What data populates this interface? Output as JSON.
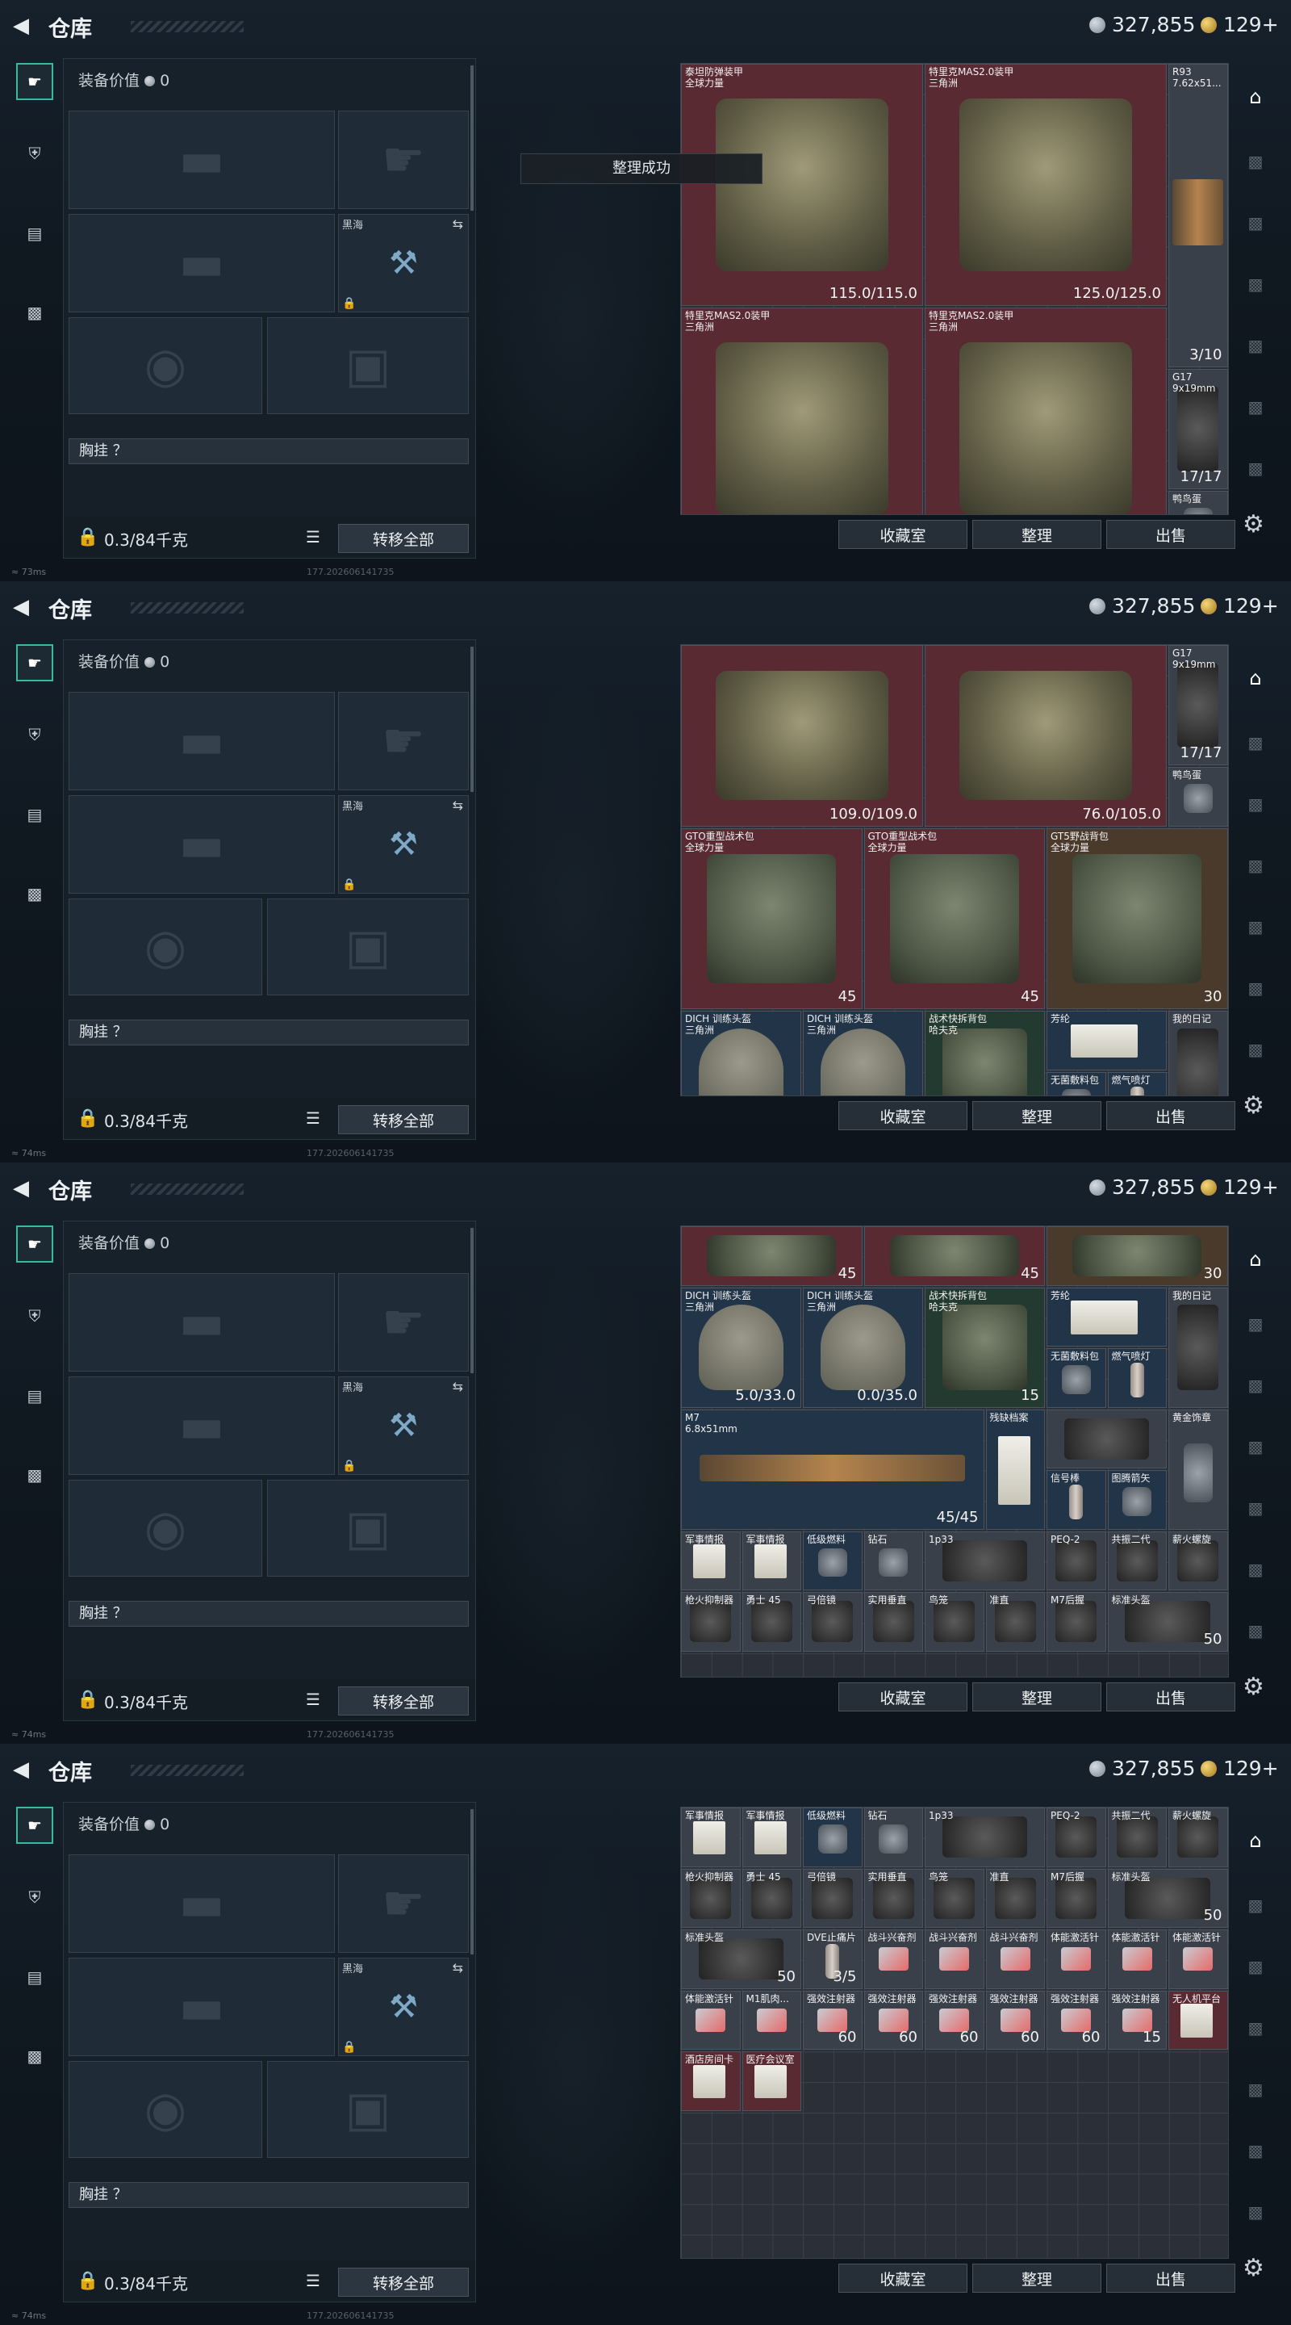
{
  "header": {
    "title": "仓库",
    "silver": "327,855",
    "gold": "129+"
  },
  "left_panel": {
    "equip_value_label": "装备价值",
    "equip_value": "0",
    "melee_name": "黑海",
    "vest_label": "胸挂 ？",
    "weight": "0.3/84千克",
    "transfer_all": "转移全部"
  },
  "footer_buttons": {
    "collection": "收藏室",
    "sort": "整理",
    "sell": "出售"
  },
  "toast": "整理成功",
  "frames": [
    {
      "ping": "73ms",
      "build": "177.202606141735",
      "items": [
        {
          "name": "泰坦防弹装甲\n全球力量",
          "value": "115.0/115.0",
          "x": 0,
          "y": 0,
          "w": 4,
          "h": 4,
          "bg": "red",
          "pic": "vest"
        },
        {
          "name": "特里克MAS2.0装甲\n三角洲",
          "value": "125.0/125.0",
          "x": 4,
          "y": 0,
          "w": 4,
          "h": 4,
          "bg": "red",
          "pic": "vest"
        },
        {
          "name": "R93\n7.62x51...",
          "value": "3/10",
          "x": 8,
          "y": 0,
          "w": 1,
          "h": 5,
          "bg": "gry",
          "pic": "gun"
        },
        {
          "name": "特里克MAS2.0装甲\n三角洲",
          "value": "",
          "x": 0,
          "y": 4,
          "w": 4,
          "h": 4,
          "bg": "red",
          "pic": "vest"
        },
        {
          "name": "特里克MAS2.0装甲\n三角洲",
          "value": "",
          "x": 4,
          "y": 4,
          "w": 4,
          "h": 4,
          "bg": "red",
          "pic": "vest"
        },
        {
          "name": "G17\n9x19mm",
          "value": "17/17",
          "x": 8,
          "y": 5,
          "w": 1,
          "h": 2,
          "bg": "gry",
          "pic": "dark"
        },
        {
          "name": "鸭鸟蛋",
          "value": "",
          "x": 8,
          "y": 7,
          "w": 1,
          "h": 1,
          "bg": "gry",
          "pic": "sm"
        }
      ]
    },
    {
      "ping": "74ms",
      "build": "177.202606141735",
      "items": [
        {
          "name": "",
          "value": "109.0/109.0",
          "x": 0,
          "y": 0,
          "w": 4,
          "h": 3,
          "bg": "red",
          "pic": "vest"
        },
        {
          "name": "",
          "value": "76.0/105.0",
          "x": 4,
          "y": 0,
          "w": 4,
          "h": 3,
          "bg": "red",
          "pic": "vest"
        },
        {
          "name": "G17\n9x19mm",
          "value": "17/17",
          "x": 8,
          "y": 0,
          "w": 1,
          "h": 2,
          "bg": "gry",
          "pic": "dark"
        },
        {
          "name": "鸭鸟蛋",
          "value": "",
          "x": 8,
          "y": 2,
          "w": 1,
          "h": 1,
          "bg": "gry",
          "pic": "sm"
        },
        {
          "name": "GTO重型战术包\n全球力量",
          "value": "45",
          "x": 0,
          "y": 3,
          "w": 3,
          "h": 3,
          "bg": "red",
          "pic": "pack"
        },
        {
          "name": "GTO重型战术包\n全球力量",
          "value": "45",
          "x": 3,
          "y": 3,
          "w": 3,
          "h": 3,
          "bg": "red",
          "pic": "pack"
        },
        {
          "name": "GT5野战背包\n全球力量",
          "value": "30",
          "x": 6,
          "y": 3,
          "w": 3,
          "h": 3,
          "bg": "brn",
          "pic": "pack"
        },
        {
          "name": "DICH 训练头盔\n三角洲",
          "value": "",
          "x": 0,
          "y": 6,
          "w": 2,
          "h": 2,
          "bg": "blu",
          "pic": "helm"
        },
        {
          "name": "DICH 训练头盔\n三角洲",
          "value": "",
          "x": 2,
          "y": 6,
          "w": 2,
          "h": 2,
          "bg": "blu",
          "pic": "helm"
        },
        {
          "name": "战术快拆背包\n哈夫克",
          "value": "",
          "x": 4,
          "y": 6,
          "w": 2,
          "h": 2,
          "bg": "grn",
          "pic": "pack"
        },
        {
          "name": "芳纶",
          "value": "",
          "x": 6,
          "y": 6,
          "w": 2,
          "h": 1,
          "bg": "blu",
          "pic": "doc"
        },
        {
          "name": "我的日记",
          "value": "",
          "x": 8,
          "y": 6,
          "w": 1,
          "h": 2,
          "bg": "gry",
          "pic": "dark"
        },
        {
          "name": "无菌敷料包",
          "value": "",
          "x": 6,
          "y": 7,
          "w": 1,
          "h": 1,
          "bg": "blu",
          "pic": "sm"
        },
        {
          "name": "燃气喷灯",
          "value": "",
          "x": 7,
          "y": 7,
          "w": 1,
          "h": 1,
          "bg": "blu",
          "pic": "cyl"
        }
      ]
    },
    {
      "ping": "74ms",
      "build": "177.202606141735",
      "items": [
        {
          "name": "",
          "value": "45",
          "x": 0,
          "y": 0,
          "w": 3,
          "h": 1,
          "bg": "red",
          "pic": "pack"
        },
        {
          "name": "",
          "value": "45",
          "x": 3,
          "y": 0,
          "w": 3,
          "h": 1,
          "bg": "red",
          "pic": "pack"
        },
        {
          "name": "",
          "value": "30",
          "x": 6,
          "y": 0,
          "w": 3,
          "h": 1,
          "bg": "brn",
          "pic": "pack"
        },
        {
          "name": "DICH 训练头盔\n三角洲",
          "value": "5.0/33.0",
          "x": 0,
          "y": 1,
          "w": 2,
          "h": 2,
          "bg": "blu",
          "pic": "helm"
        },
        {
          "name": "DICH 训练头盔\n三角洲",
          "value": "0.0/35.0",
          "x": 2,
          "y": 1,
          "w": 2,
          "h": 2,
          "bg": "blu",
          "pic": "helm"
        },
        {
          "name": "战术快拆背包\n哈夫克",
          "value": "15",
          "x": 4,
          "y": 1,
          "w": 2,
          "h": 2,
          "bg": "grn",
          "pic": "pack"
        },
        {
          "name": "芳纶",
          "value": "",
          "x": 6,
          "y": 1,
          "w": 2,
          "h": 1,
          "bg": "blu",
          "pic": "doc"
        },
        {
          "name": "我的日记",
          "value": "",
          "x": 8,
          "y": 1,
          "w": 1,
          "h": 2,
          "bg": "gry",
          "pic": "dark"
        },
        {
          "name": "无菌敷料包",
          "value": "",
          "x": 6,
          "y": 2,
          "w": 1,
          "h": 1,
          "bg": "blu",
          "pic": "sm"
        },
        {
          "name": "燃气喷灯",
          "value": "",
          "x": 7,
          "y": 2,
          "w": 1,
          "h": 1,
          "bg": "blu",
          "pic": "cyl"
        },
        {
          "name": "M7\n6.8x51mm",
          "value": "45/45",
          "x": 0,
          "y": 3,
          "w": 5,
          "h": 2,
          "bg": "blu",
          "pic": "gun"
        },
        {
          "name": "残缺档案",
          "value": "",
          "x": 5,
          "y": 3,
          "w": 1,
          "h": 2,
          "bg": "blu",
          "pic": "doc"
        },
        {
          "name": "",
          "value": "",
          "x": 6,
          "y": 3,
          "w": 2,
          "h": 1,
          "bg": "gry",
          "pic": "dark"
        },
        {
          "name": "黄金饰章",
          "value": "",
          "x": 8,
          "y": 3,
          "w": 1,
          "h": 2,
          "bg": "gry",
          "pic": "sm"
        },
        {
          "name": "信号棒",
          "value": "",
          "x": 6,
          "y": 4,
          "w": 1,
          "h": 1,
          "bg": "blu",
          "pic": "cyl"
        },
        {
          "name": "图腾箭矢",
          "value": "",
          "x": 7,
          "y": 4,
          "w": 1,
          "h": 1,
          "bg": "blu",
          "pic": "sm"
        },
        {
          "name": "军事情报",
          "value": "",
          "x": 0,
          "y": 5,
          "w": 1,
          "h": 1,
          "bg": "gry",
          "pic": "doc"
        },
        {
          "name": "军事情报",
          "value": "",
          "x": 1,
          "y": 5,
          "w": 1,
          "h": 1,
          "bg": "gry",
          "pic": "doc"
        },
        {
          "name": "低级燃料",
          "value": "",
          "x": 2,
          "y": 5,
          "w": 1,
          "h": 1,
          "bg": "blu",
          "pic": "sm"
        },
        {
          "name": "钻石",
          "value": "",
          "x": 3,
          "y": 5,
          "w": 1,
          "h": 1,
          "bg": "gry",
          "pic": "sm"
        },
        {
          "name": "1p33",
          "value": "",
          "x": 4,
          "y": 5,
          "w": 2,
          "h": 1,
          "bg": "gry",
          "pic": "dark"
        },
        {
          "name": "PEQ-2",
          "value": "",
          "x": 6,
          "y": 5,
          "w": 1,
          "h": 1,
          "bg": "gry",
          "pic": "dark"
        },
        {
          "name": "共振二代",
          "value": "",
          "x": 7,
          "y": 5,
          "w": 1,
          "h": 1,
          "bg": "gry",
          "pic": "dark"
        },
        {
          "name": "薪火螺旋",
          "value": "",
          "x": 8,
          "y": 5,
          "w": 1,
          "h": 1,
          "bg": "gry",
          "pic": "dark"
        },
        {
          "name": "枪火抑制器",
          "value": "",
          "x": 0,
          "y": 6,
          "w": 1,
          "h": 1,
          "bg": "gry",
          "pic": "dark"
        },
        {
          "name": "勇士 45",
          "value": "",
          "x": 1,
          "y": 6,
          "w": 1,
          "h": 1,
          "bg": "gry",
          "pic": "dark"
        },
        {
          "name": "弓倍镜",
          "value": "",
          "x": 2,
          "y": 6,
          "w": 1,
          "h": 1,
          "bg": "gry",
          "pic": "dark"
        },
        {
          "name": "实用垂直",
          "value": "",
          "x": 3,
          "y": 6,
          "w": 1,
          "h": 1,
          "bg": "gry",
          "pic": "dark"
        },
        {
          "name": "鸟笼",
          "value": "",
          "x": 4,
          "y": 6,
          "w": 1,
          "h": 1,
          "bg": "gry",
          "pic": "dark"
        },
        {
          "name": "准直",
          "value": "",
          "x": 5,
          "y": 6,
          "w": 1,
          "h": 1,
          "bg": "gry",
          "pic": "dark"
        },
        {
          "name": "M7后握",
          "value": "",
          "x": 6,
          "y": 6,
          "w": 1,
          "h": 1,
          "bg": "gry",
          "pic": "dark"
        },
        {
          "name": "标准头盔",
          "value": "50",
          "x": 7,
          "y": 6,
          "w": 2,
          "h": 1,
          "bg": "gry",
          "pic": "dark"
        }
      ]
    },
    {
      "ping": "74ms",
      "build": "177.202606141735",
      "items": [
        {
          "name": "军事情报",
          "value": "",
          "x": 0,
          "y": 0,
          "w": 1,
          "h": 1,
          "bg": "gry",
          "pic": "doc"
        },
        {
          "name": "军事情报",
          "value": "",
          "x": 1,
          "y": 0,
          "w": 1,
          "h": 1,
          "bg": "gry",
          "pic": "doc"
        },
        {
          "name": "低级燃料",
          "value": "",
          "x": 2,
          "y": 0,
          "w": 1,
          "h": 1,
          "bg": "blu",
          "pic": "sm"
        },
        {
          "name": "钻石",
          "value": "",
          "x": 3,
          "y": 0,
          "w": 1,
          "h": 1,
          "bg": "gry",
          "pic": "sm"
        },
        {
          "name": "1p33",
          "value": "",
          "x": 4,
          "y": 0,
          "w": 2,
          "h": 1,
          "bg": "gry",
          "pic": "dark"
        },
        {
          "name": "PEQ-2",
          "value": "",
          "x": 6,
          "y": 0,
          "w": 1,
          "h": 1,
          "bg": "gry",
          "pic": "dark"
        },
        {
          "name": "共振二代",
          "value": "",
          "x": 7,
          "y": 0,
          "w": 1,
          "h": 1,
          "bg": "gry",
          "pic": "dark"
        },
        {
          "name": "薪火螺旋",
          "value": "",
          "x": 8,
          "y": 0,
          "w": 1,
          "h": 1,
          "bg": "gry",
          "pic": "dark"
        },
        {
          "name": "枪火抑制器",
          "value": "",
          "x": 0,
          "y": 1,
          "w": 1,
          "h": 1,
          "bg": "gry",
          "pic": "dark"
        },
        {
          "name": "勇士 45",
          "value": "",
          "x": 1,
          "y": 1,
          "w": 1,
          "h": 1,
          "bg": "gry",
          "pic": "dark"
        },
        {
          "name": "弓倍镜",
          "value": "",
          "x": 2,
          "y": 1,
          "w": 1,
          "h": 1,
          "bg": "gry",
          "pic": "dark"
        },
        {
          "name": "实用垂直",
          "value": "",
          "x": 3,
          "y": 1,
          "w": 1,
          "h": 1,
          "bg": "gry",
          "pic": "dark"
        },
        {
          "name": "鸟笼",
          "value": "",
          "x": 4,
          "y": 1,
          "w": 1,
          "h": 1,
          "bg": "gry",
          "pic": "dark"
        },
        {
          "name": "准直",
          "value": "",
          "x": 5,
          "y": 1,
          "w": 1,
          "h": 1,
          "bg": "gry",
          "pic": "dark"
        },
        {
          "name": "M7后握",
          "value": "",
          "x": 6,
          "y": 1,
          "w": 1,
          "h": 1,
          "bg": "gry",
          "pic": "dark"
        },
        {
          "name": "标准头盔",
          "value": "50",
          "x": 7,
          "y": 1,
          "w": 2,
          "h": 1,
          "bg": "gry",
          "pic": "dark"
        },
        {
          "name": "标准头盔",
          "value": "50",
          "x": 0,
          "y": 2,
          "w": 2,
          "h": 1,
          "bg": "gry",
          "pic": "dark"
        },
        {
          "name": "DVE止痛片",
          "value": "3/5",
          "x": 2,
          "y": 2,
          "w": 1,
          "h": 1,
          "bg": "gry",
          "pic": "cyl"
        },
        {
          "name": "战斗兴奋剂",
          "value": "",
          "x": 3,
          "y": 2,
          "w": 1,
          "h": 1,
          "bg": "gry",
          "pic": "syr"
        },
        {
          "name": "战斗兴奋剂",
          "value": "",
          "x": 4,
          "y": 2,
          "w": 1,
          "h": 1,
          "bg": "gry",
          "pic": "syr"
        },
        {
          "name": "战斗兴奋剂",
          "value": "",
          "x": 5,
          "y": 2,
          "w": 1,
          "h": 1,
          "bg": "gry",
          "pic": "syr"
        },
        {
          "name": "体能激活针",
          "value": "",
          "x": 6,
          "y": 2,
          "w": 1,
          "h": 1,
          "bg": "gry",
          "pic": "syr"
        },
        {
          "name": "体能激活针",
          "value": "",
          "x": 7,
          "y": 2,
          "w": 1,
          "h": 1,
          "bg": "gry",
          "pic": "syr"
        },
        {
          "name": "体能激活针",
          "value": "",
          "x": 8,
          "y": 2,
          "w": 1,
          "h": 1,
          "bg": "gry",
          "pic": "syr"
        },
        {
          "name": "体能激活针",
          "value": "",
          "x": 0,
          "y": 3,
          "w": 1,
          "h": 1,
          "bg": "gry",
          "pic": "syr"
        },
        {
          "name": "M1肌肉...",
          "value": "",
          "x": 1,
          "y": 3,
          "w": 1,
          "h": 1,
          "bg": "gry",
          "pic": "syr"
        },
        {
          "name": "强效注射器",
          "value": "60",
          "x": 2,
          "y": 3,
          "w": 1,
          "h": 1,
          "bg": "gry",
          "pic": "syr"
        },
        {
          "name": "强效注射器",
          "value": "60",
          "x": 3,
          "y": 3,
          "w": 1,
          "h": 1,
          "bg": "gry",
          "pic": "syr"
        },
        {
          "name": "强效注射器",
          "value": "60",
          "x": 4,
          "y": 3,
          "w": 1,
          "h": 1,
          "bg": "gry",
          "pic": "syr"
        },
        {
          "name": "强效注射器",
          "value": "60",
          "x": 5,
          "y": 3,
          "w": 1,
          "h": 1,
          "bg": "gry",
          "pic": "syr"
        },
        {
          "name": "强效注射器",
          "value": "60",
          "x": 6,
          "y": 3,
          "w": 1,
          "h": 1,
          "bg": "gry",
          "pic": "syr"
        },
        {
          "name": "强效注射器",
          "value": "15",
          "x": 7,
          "y": 3,
          "w": 1,
          "h": 1,
          "bg": "gry",
          "pic": "syr"
        },
        {
          "name": "无人机平台",
          "value": "",
          "x": 8,
          "y": 3,
          "w": 1,
          "h": 1,
          "bg": "red",
          "pic": "doc"
        },
        {
          "name": "酒店房间卡",
          "value": "",
          "x": 0,
          "y": 4,
          "w": 1,
          "h": 1,
          "bg": "red",
          "pic": "doc"
        },
        {
          "name": "医疗会议室",
          "value": "",
          "x": 1,
          "y": 4,
          "w": 1,
          "h": 1,
          "bg": "red",
          "pic": "doc"
        }
      ]
    }
  ]
}
